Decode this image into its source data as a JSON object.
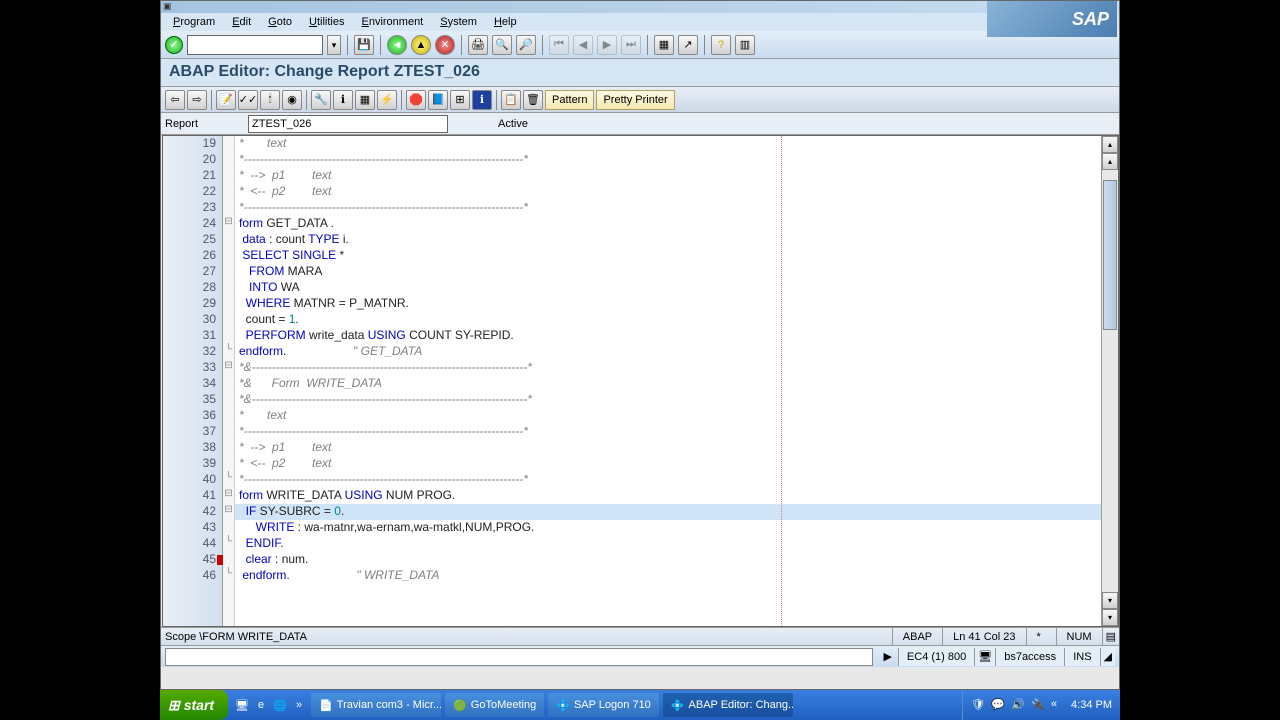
{
  "menubar": [
    "Program",
    "Edit",
    "Goto",
    "Utilities",
    "Environment",
    "System",
    "Help"
  ],
  "page_title": "ABAP Editor: Change Report ZTEST_026",
  "report": {
    "label": "Report",
    "name": "ZTEST_026",
    "status": "Active"
  },
  "toolbar2_text_buttons": [
    "Pattern",
    "Pretty Printer"
  ],
  "code_lines": [
    {
      "n": 19,
      "html": "<span class='cm'>*       text</span>"
    },
    {
      "n": 20,
      "html": "<span class='cm'>*----------------------------------------------------------------------*</span>"
    },
    {
      "n": 21,
      "html": "<span class='cm'>*  --&gt;  p1        text</span>"
    },
    {
      "n": 22,
      "html": "<span class='cm'>*  &lt;--  p2        text</span>"
    },
    {
      "n": 23,
      "html": "<span class='cm'>*----------------------------------------------------------------------*</span>"
    },
    {
      "n": 24,
      "fold": "⊟",
      "html": "<span class='kw'>form</span> GET_DATA ."
    },
    {
      "n": 25,
      "html": " <span class='kw'>data</span> : count <span class='kw'>TYPE</span> i."
    },
    {
      "n": 26,
      "html": " <span class='kw'>SELECT SINGLE</span> *"
    },
    {
      "n": 27,
      "html": "   <span class='kw'>FROM</span> MARA"
    },
    {
      "n": 28,
      "html": "   <span class='kw'>INTO</span> WA"
    },
    {
      "n": 29,
      "html": "  <span class='kw'>WHERE</span> MATNR = P_MATNR."
    },
    {
      "n": 30,
      "html": "  count = <span class='num'>1</span>."
    },
    {
      "n": 31,
      "html": "  <span class='kw'>PERFORM</span> write_data <span class='kw'>USING</span> COUNT SY-REPID."
    },
    {
      "n": 32,
      "fold": "└",
      "html": "<span class='kw'>endform</span>.                    <span class='cm'>\" GET_DATA</span>"
    },
    {
      "n": 33,
      "fold": "⊟",
      "html": "<span class='cm'>*&amp;---------------------------------------------------------------------*</span>"
    },
    {
      "n": 34,
      "html": "<span class='cm'>*&amp;      Form  WRITE_DATA</span>"
    },
    {
      "n": 35,
      "html": "<span class='cm'>*&amp;---------------------------------------------------------------------*</span>"
    },
    {
      "n": 36,
      "html": "<span class='cm'>*       text</span>"
    },
    {
      "n": 37,
      "html": "<span class='cm'>*----------------------------------------------------------------------*</span>"
    },
    {
      "n": 38,
      "html": "<span class='cm'>*  --&gt;  p1        text</span>"
    },
    {
      "n": 39,
      "html": "<span class='cm'>*  &lt;--  p2        text</span>"
    },
    {
      "n": 40,
      "fold": "└",
      "html": "<span class='cm'>*----------------------------------------------------------------------*</span>"
    },
    {
      "n": 41,
      "fold": "⊟",
      "html": "<span class='kw'>form</span> WRITE_DATA <span class='kw'>USING</span> NUM PROG."
    },
    {
      "n": 42,
      "fold": "⊟",
      "highlight": true,
      "html": "  <span class='kw'>IF</span> SY-SUBRC = <span class='num'>0</span>."
    },
    {
      "n": 43,
      "html": "     <span class='kw'>WRITE</span> : wa-matnr,wa-ernam,wa-matkl,NUM,PROG."
    },
    {
      "n": 44,
      "fold": "└",
      "html": "  <span class='kw'>ENDIF</span>."
    },
    {
      "n": 45,
      "breakpoint": true,
      "html": "  <span class='kw'>clear</span> : num."
    },
    {
      "n": 46,
      "fold": "└",
      "html": " <span class='kw'>endform</span>.                    <span class='cm'>\" WRITE_DATA</span>"
    }
  ],
  "scope": {
    "label": "Scope \\FORM WRITE_DATA",
    "lang": "ABAP",
    "pos": "Ln 41 Col 23",
    "mod": "*",
    "num": "NUM"
  },
  "status": {
    "system": "EC4 (1) 800",
    "server": "bs7access",
    "mode": "INS"
  },
  "taskbar": {
    "start": "start",
    "items": [
      {
        "icon": "📄",
        "label": "Travian com3 - Micr..."
      },
      {
        "icon": "🟢",
        "label": "GoToMeeting"
      },
      {
        "icon": "💠",
        "label": "SAP Logon 710"
      },
      {
        "icon": "💠",
        "label": "ABAP Editor: Chang...",
        "active": true
      }
    ],
    "clock": "4:34 PM"
  }
}
